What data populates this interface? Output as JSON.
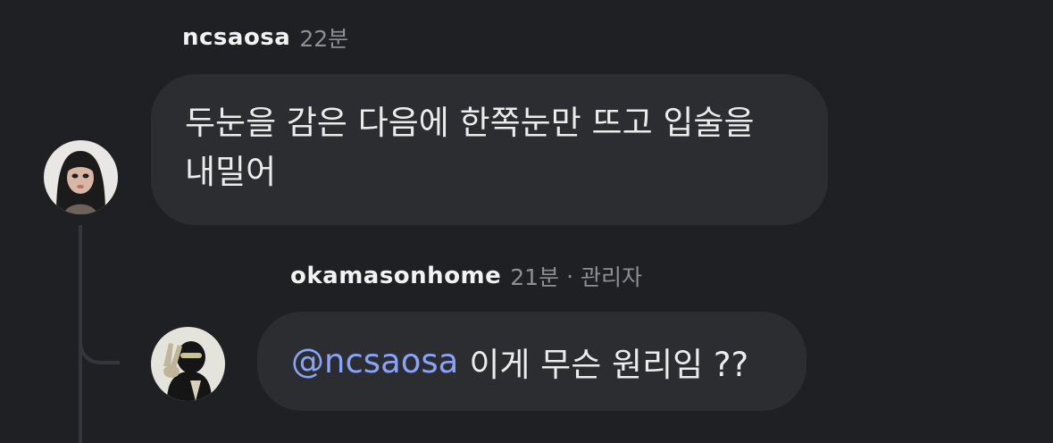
{
  "comments": [
    {
      "username": "ncsaosa",
      "time": "22분",
      "text_line1": "두눈을 감은 다음에 한쪽눈만 뜨고 입술을",
      "text_line2": "내밀어"
    },
    {
      "username": "okamasonhome",
      "time": "21분",
      "separator": "·",
      "role": "관리자",
      "mention": "@ncsaosa",
      "text": "이게 무슨 원리임 ??"
    }
  ],
  "colors": {
    "background": "#1f2023",
    "bubble": "#2b2d31",
    "mention": "#8aa2f7",
    "muted": "#8d8f94",
    "thread_line": "#34363b"
  }
}
